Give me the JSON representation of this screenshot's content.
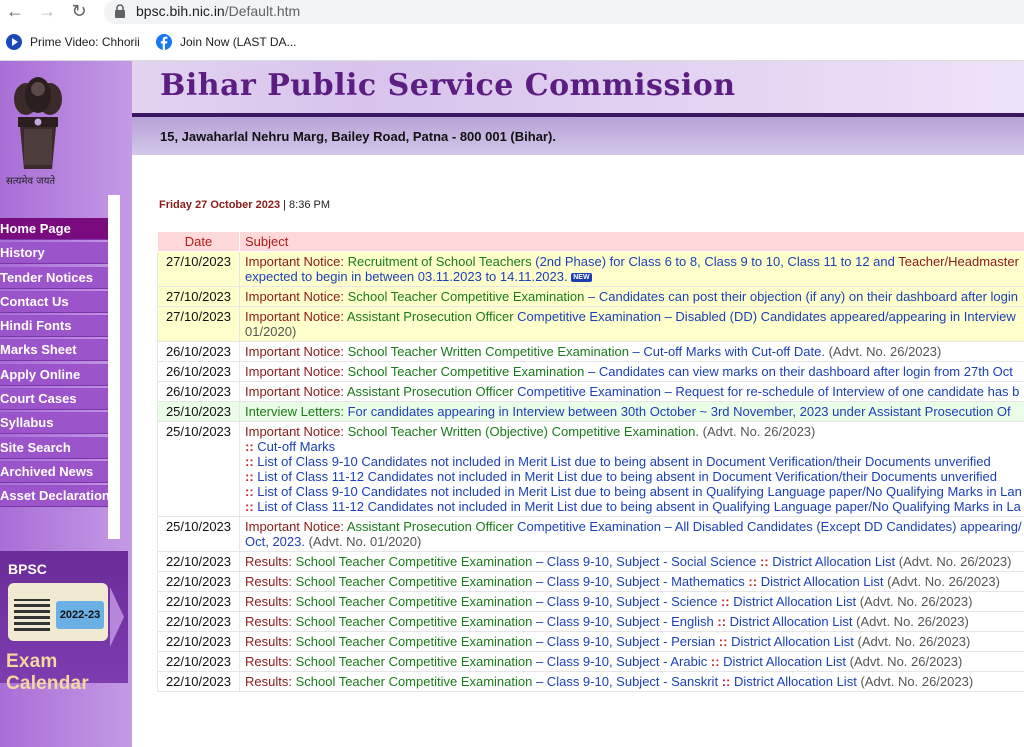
{
  "browser": {
    "url_host": "bpsc.bih.nic.in",
    "url_path": "/Default.htm",
    "bookmarks": [
      {
        "label": "Prime Video: Chhorii",
        "icon": "play-icon",
        "color": "#1a4ab8"
      },
      {
        "label": "Join Now (LAST DA...",
        "icon": "facebook-icon",
        "color": "#1877f2"
      }
    ]
  },
  "header": {
    "title": "Bihar Public Service Commission",
    "address": "15, Jawaharlal Nehru Marg, Bailey Road, Patna - 800 001 (Bihar).",
    "motto": "सत्यमेव जयते"
  },
  "menu": [
    {
      "label": "Home Page",
      "active": true
    },
    {
      "label": "History"
    },
    {
      "label": "Tender Notices"
    },
    {
      "label": "Contact Us"
    },
    {
      "label": "Hindi Fonts"
    },
    {
      "label": "Marks Sheet"
    },
    {
      "label": "Apply Online"
    },
    {
      "label": "Court Cases"
    },
    {
      "label": "Syllabus"
    },
    {
      "label": "Site Search"
    },
    {
      "label": "Archived News"
    },
    {
      "label": "Asset Declaration"
    }
  ],
  "calendar": {
    "brand": "BPSC",
    "year": "2022-23",
    "caption": "Exam Calendar"
  },
  "dateline": {
    "date": "Friday 27 October 2023",
    "sep": "|",
    "time": "8:36 PM"
  },
  "table": {
    "headers": {
      "date": "Date",
      "subject": "Subject"
    },
    "rows": [
      {
        "date": "27/10/2023",
        "style": "hl",
        "parts": [
          {
            "c": "lbl",
            "t": "Important Notice: "
          },
          {
            "c": "grn",
            "t": "Recruitment of School Teachers "
          },
          {
            "c": "blu",
            "t": "(2nd Phase) for Class 6 to 8, Class 9 to 10, Class 11 to 12 and "
          },
          {
            "c": "lbl",
            "t": "Teacher/Headmaster"
          }
        ],
        "line2": "expected to begin in between 03.11.2023 to 14.11.2023.",
        "badge": "NEW"
      },
      {
        "date": "27/10/2023",
        "style": "hl",
        "parts": [
          {
            "c": "lbl",
            "t": "Important Notice: "
          },
          {
            "c": "grn",
            "t": "School Teacher Competitive Examination "
          },
          {
            "c": "blu",
            "t": "– Candidates can post their objection (if any) on their dashboard after login"
          }
        ]
      },
      {
        "date": "27/10/2023",
        "style": "hl",
        "parts": [
          {
            "c": "lbl",
            "t": "Important Notice: "
          },
          {
            "c": "grn",
            "t": "Assistant Prosecution Officer "
          },
          {
            "c": "blu",
            "t": "Competitive Examination – Disabled (DD) Candidates appeared/appearing in Interview"
          }
        ],
        "line2": "01/2020)",
        "line2_class": "mut"
      },
      {
        "date": "26/10/2023",
        "parts": [
          {
            "c": "lbl",
            "t": "Important Notice: "
          },
          {
            "c": "grn",
            "t": "School Teacher Written Competitive Examination "
          },
          {
            "c": "blu",
            "t": "– Cut-off Marks with Cut-off Date. "
          },
          {
            "c": "mut",
            "t": "(Advt. No. 26/2023)"
          }
        ]
      },
      {
        "date": "26/10/2023",
        "parts": [
          {
            "c": "lbl",
            "t": "Important Notice: "
          },
          {
            "c": "grn",
            "t": "School Teacher Competitive Examination "
          },
          {
            "c": "blu",
            "t": "– Candidates can view marks on their dashboard after login from 27th Oct"
          }
        ]
      },
      {
        "date": "26/10/2023",
        "parts": [
          {
            "c": "lbl",
            "t": "Important Notice: "
          },
          {
            "c": "grn",
            "t": "Assistant Prosecution Officer "
          },
          {
            "c": "blu",
            "t": "Competitive Examination – Request for re-schedule of Interview of one candidate has b"
          }
        ]
      },
      {
        "date": "25/10/2023",
        "style": "gr",
        "parts": [
          {
            "c": "grn",
            "t": "Interview Letters: "
          },
          {
            "c": "blu",
            "t": "For candidates appearing in Interview between 30th October ~ 3rd November, 2023 under Assistant Prosecution Of"
          }
        ]
      },
      {
        "date": "25/10/2023",
        "parts": [
          {
            "c": "lbl",
            "t": "Important Notice: "
          },
          {
            "c": "grn",
            "t": "School Teacher Written (Objective) Competitive Examination. "
          },
          {
            "c": "mut",
            "t": "(Advt. No. 26/2023)"
          }
        ],
        "subitems": [
          "Cut-off Marks",
          "List of Class 9-10 Candidates not included in Merit List due to being absent in Document Verification/their Documents unverified",
          "List of Class 11-12 Candidates not included in Merit List due to being absent in Document Verification/their Documents unverified",
          "List of Class 9-10 Candidates not included in Merit List due to being absent in Qualifying Language paper/No Qualifying Marks in Lan",
          "List of Class 11-12 Candidates not included in Merit List due to being absent in Qualifying Language paper/No Qualifying Marks in La"
        ],
        "sub_sep": "::"
      },
      {
        "date": "25/10/2023",
        "parts": [
          {
            "c": "lbl",
            "t": "Important Notice: "
          },
          {
            "c": "grn",
            "t": "Assistant Prosecution Officer "
          },
          {
            "c": "blu",
            "t": "Competitive Examination – All Disabled Candidates (Except DD Candidates) appearing/"
          }
        ],
        "line2": "Oct, 2023.",
        "line2_tail": " (Advt. No. 01/2020)"
      },
      {
        "date": "22/10/2023",
        "results": true,
        "subject": "Social Science",
        "tail": "District Allocation List",
        "advt": "(Advt. No. 26/2023)"
      },
      {
        "date": "22/10/2023",
        "results": true,
        "subject": "Mathematics",
        "tail": "District Allocation List",
        "advt": "(Advt. No. 26/2023)"
      },
      {
        "date": "22/10/2023",
        "results": true,
        "subject": "Science",
        "tail": "District Allocation List",
        "advt": "(Advt. No. 26/2023)"
      },
      {
        "date": "22/10/2023",
        "results": true,
        "subject": "English",
        "tail": "District Allocation List",
        "advt": "(Advt. No. 26/2023)"
      },
      {
        "date": "22/10/2023",
        "results": true,
        "subject": "Persian",
        "tail": "District Allocation List",
        "advt": "(Advt. No. 26/2023)"
      },
      {
        "date": "22/10/2023",
        "results": true,
        "subject": "Arabic",
        "tail": "District Allocation List",
        "advt": "(Advt. No. 26/2023)"
      },
      {
        "date": "22/10/2023",
        "results": true,
        "subject": "Sanskrit",
        "tail": "District Allocation List",
        "advt": "(Advt. No. 26/2023)"
      }
    ],
    "results_prefix": "Results: ",
    "results_exam": "School Teacher Competitive Examination ",
    "results_class": "– Class 9-10, Subject - ",
    "results_sep": "::"
  }
}
